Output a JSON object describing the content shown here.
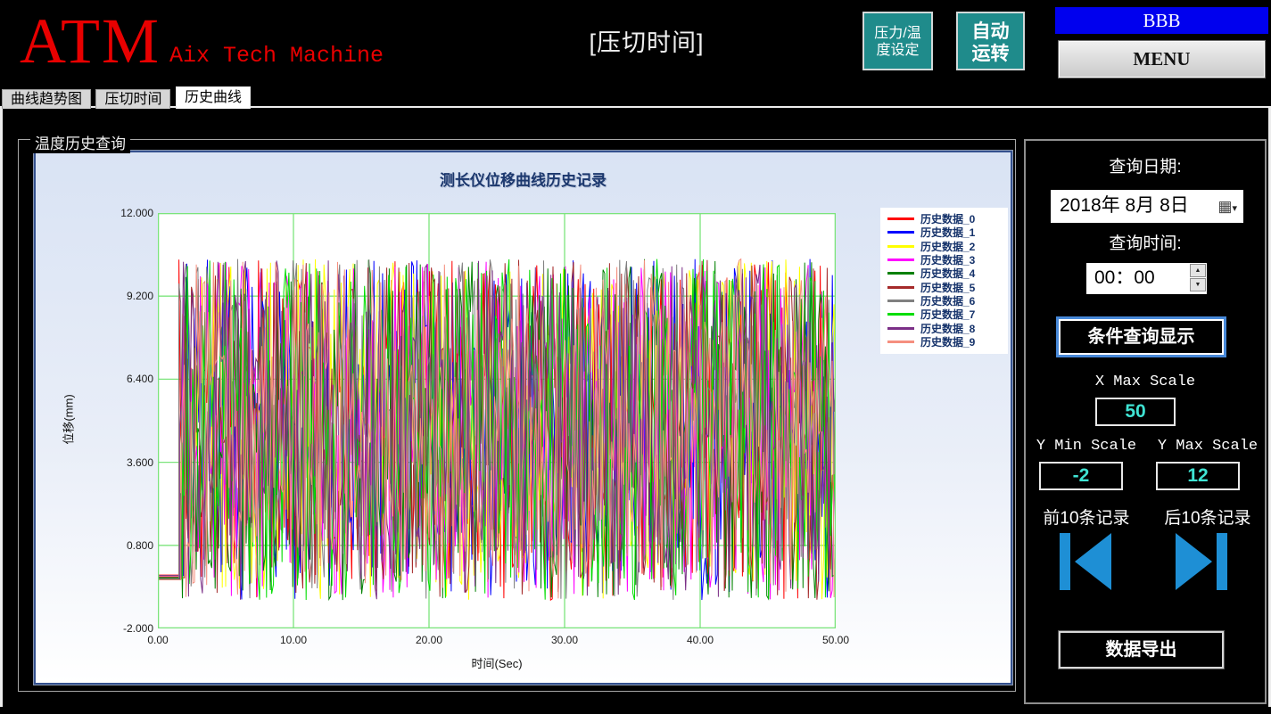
{
  "header": {
    "logo": "ATM",
    "logo_sub": "Aix Tech Machine",
    "page_title": "[压切时间]",
    "pressure_temp_button": {
      "line1": "压力/温",
      "line2": "度设定"
    },
    "auto_run_button": {
      "line1": "自动",
      "line2": "运转"
    },
    "bbb_label": "BBB",
    "menu_label": "MENU",
    "teal_color": "#1f8b8b",
    "bbb_color": "#0000ee"
  },
  "tabs": [
    {
      "label": "曲线趋势图",
      "active": false
    },
    {
      "label": "压切时间",
      "active": false
    },
    {
      "label": "历史曲线",
      "active": true
    }
  ],
  "groupbox_title": "温度历史查询",
  "chart_data": {
    "type": "line",
    "title": "测长仪位移曲线历史记录",
    "xlabel": "时间(Sec)",
    "ylabel": "位移(mm)",
    "xlim": [
      0,
      50
    ],
    "ylim": [
      -2,
      12
    ],
    "x_ticks": [
      "0.00",
      "10.00",
      "20.00",
      "30.00",
      "40.00",
      "50.00"
    ],
    "y_ticks": [
      "12.000",
      "9.200",
      "6.400",
      "3.600",
      "0.800",
      "-2.000"
    ],
    "x_grid": [
      10,
      20,
      30,
      40
    ],
    "y_grid": [
      9.2,
      6.4,
      3.6,
      0.8
    ],
    "grid": true,
    "grid_color": "#7ce47c",
    "plot_bg": "#ffffff",
    "legend_position": "outside-top-right",
    "series": [
      {
        "name": "历史数据_0",
        "color": "#ff0000"
      },
      {
        "name": "历史数据_1",
        "color": "#0000ff"
      },
      {
        "name": "历史数据_2",
        "color": "#ffff00"
      },
      {
        "name": "历史数据_3",
        "color": "#ff00ff"
      },
      {
        "name": "历史数据_4",
        "color": "#008000"
      },
      {
        "name": "历史数据_5",
        "color": "#a52a2a"
      },
      {
        "name": "历史数据_6",
        "color": "#808080"
      },
      {
        "name": "历史数据_7",
        "color": "#00dd00"
      },
      {
        "name": "历史数据_8",
        "color": "#7b2f87"
      },
      {
        "name": "历史数据_9",
        "color": "#f58f7f"
      }
    ],
    "noise": {
      "description": "each series flat near -0.2 mm until ~1.8 s, then dense random oscillation",
      "flat_value": -0.2,
      "noise_start_x": 1.8,
      "min": -1.05,
      "base_max": 9.6,
      "spike_max": 10.45,
      "spike_prob": 0.1,
      "points": 380
    }
  },
  "sidebar": {
    "date_label": "查询日期:",
    "date_value": "2018年 8月 8日",
    "time_label": "查询时间:",
    "time_value": "00：00",
    "query_button": "条件查询显示",
    "x_max_label": "X Max Scale",
    "x_max_value": "50",
    "y_min_label": "Y Min Scale",
    "y_min_value": "-2",
    "y_max_label": "Y Max Scale",
    "y_max_value": "12",
    "prev_label": "前10条记录",
    "next_label": "后10条记录",
    "export_button": "数据导出",
    "value_color": "#3fe3d3",
    "arrow_color": "#1e8fd5"
  },
  "icons": {
    "calendar": "▦",
    "dropdown_arrow": "▾",
    "spin_up": "▲",
    "spin_down": "▼"
  }
}
